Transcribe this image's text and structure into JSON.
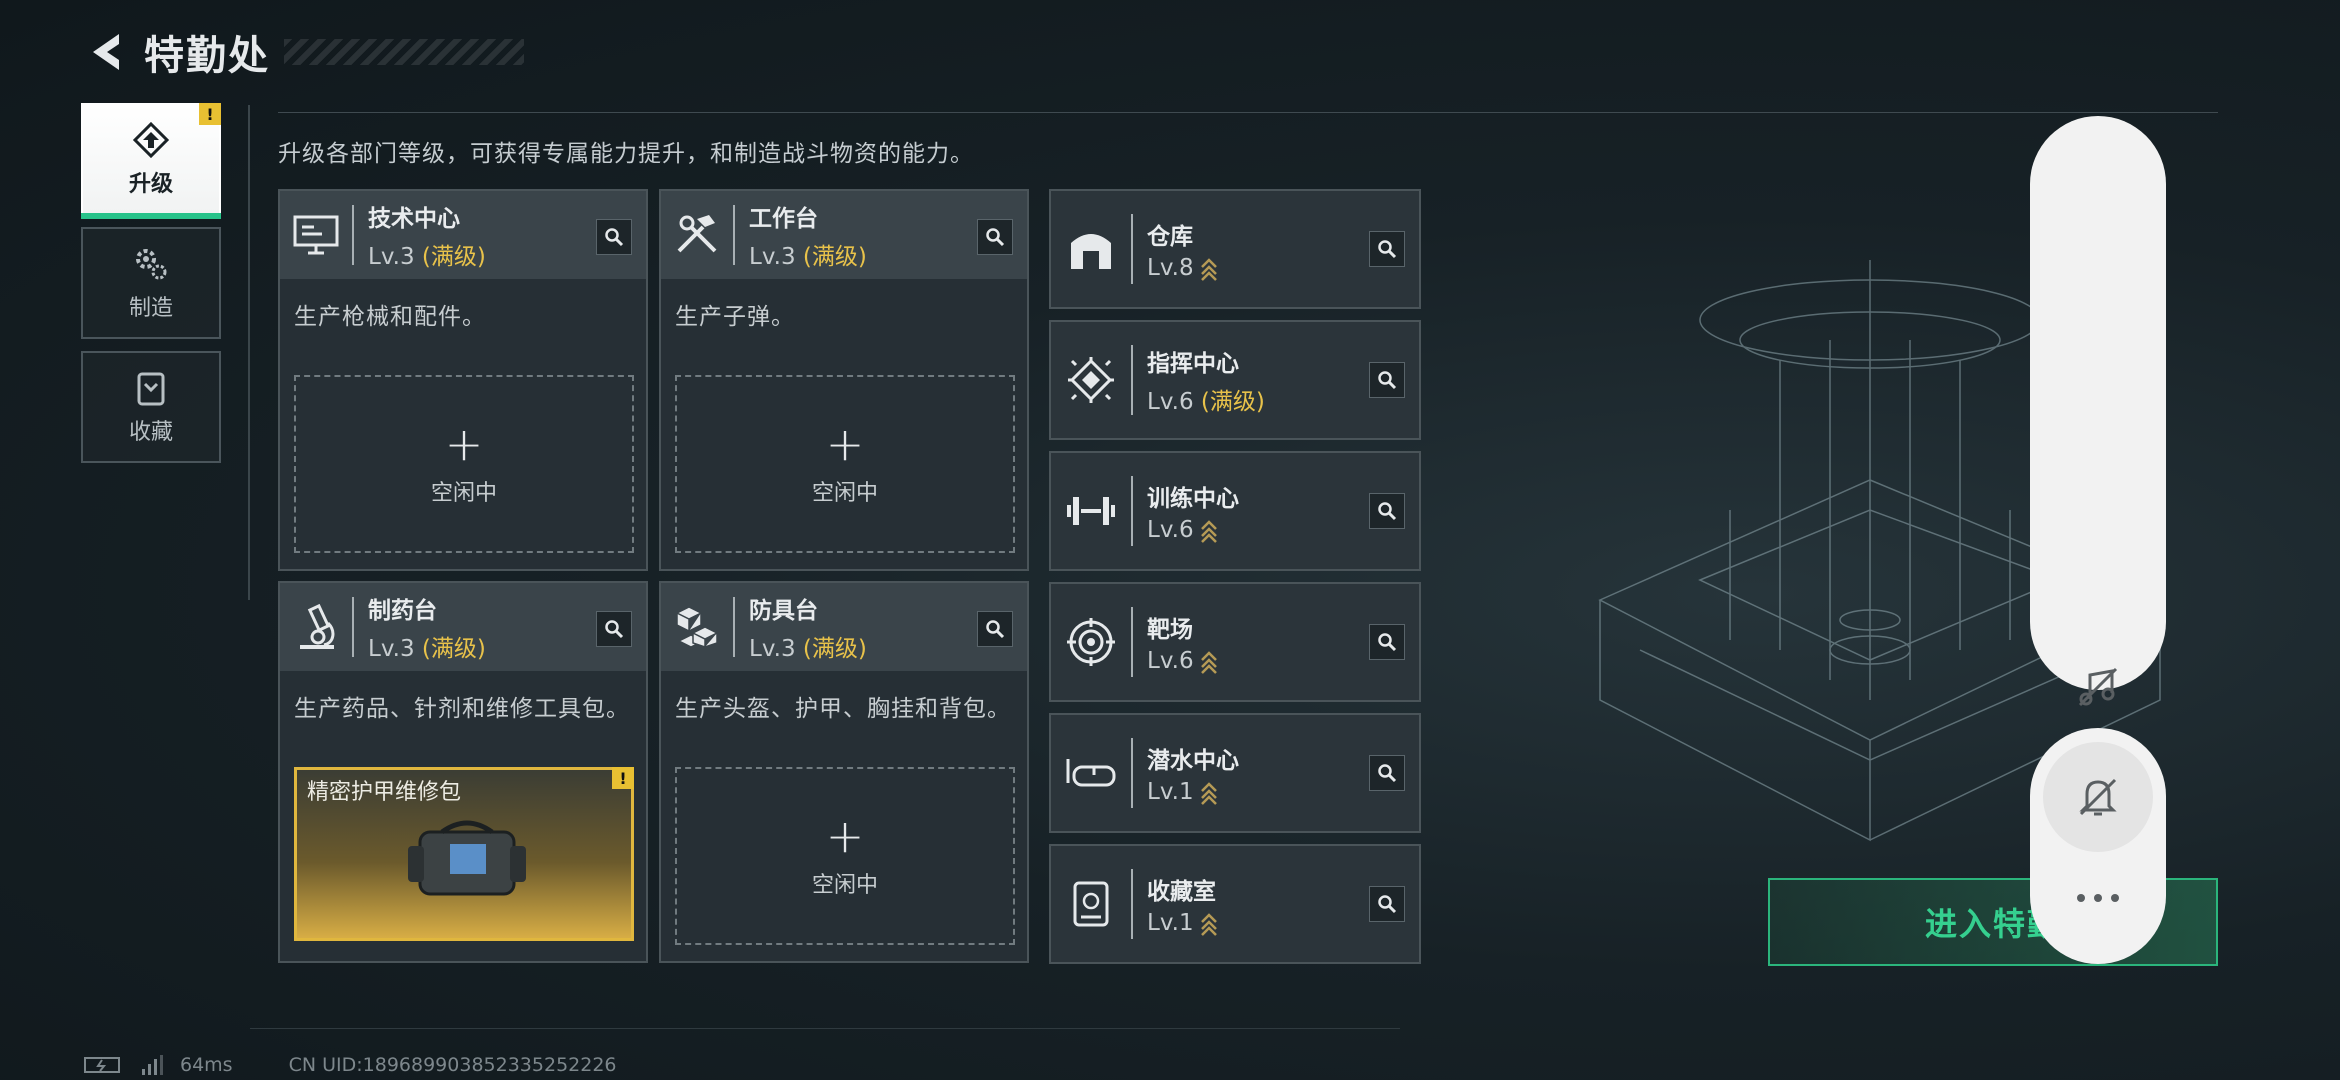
{
  "header": {
    "title": "特勤处"
  },
  "sidebar": {
    "items": [
      {
        "label": "升级",
        "icon": "upgrade-icon",
        "active": true,
        "badge": "!"
      },
      {
        "label": "制造",
        "icon": "gears-icon",
        "active": false
      },
      {
        "label": "收藏",
        "icon": "collection-icon",
        "active": false
      }
    ]
  },
  "hint": "升级各部门等级，可获得专属能力提升，和制造战斗物资的能力。",
  "workshops": [
    {
      "name": "技术中心",
      "level": "Lv.3",
      "max_tag": "(满级)",
      "desc": "生产枪械和配件。",
      "slot_status": "空闲中",
      "icon": "computer-icon"
    },
    {
      "name": "工作台",
      "level": "Lv.3",
      "max_tag": "(满级)",
      "desc": "生产子弹。",
      "slot_status": "空闲中",
      "icon": "tools-icon"
    },
    {
      "name": "制药台",
      "level": "Lv.3",
      "max_tag": "(满级)",
      "desc": "生产药品、针剂和维修工具包。",
      "product_name": "精密护甲维修包",
      "product_badge": "!",
      "icon": "microscope-icon"
    },
    {
      "name": "防具台",
      "level": "Lv.3",
      "max_tag": "(满级)",
      "desc": "生产头盔、护甲、胸挂和背包。",
      "slot_status": "空闲中",
      "icon": "cubes-icon"
    }
  ],
  "facilities": [
    {
      "name": "仓库",
      "level": "Lv.8",
      "max_tag": "",
      "upgradable": true,
      "icon": "warehouse-icon"
    },
    {
      "name": "指挥中心",
      "level": "Lv.6",
      "max_tag": "(满级)",
      "upgradable": false,
      "icon": "chip-icon"
    },
    {
      "name": "训练中心",
      "level": "Lv.6",
      "max_tag": "",
      "upgradable": true,
      "icon": "dumbbell-icon"
    },
    {
      "name": "靶场",
      "level": "Lv.6",
      "max_tag": "",
      "upgradable": true,
      "icon": "target-icon"
    },
    {
      "name": "潜水中心",
      "level": "Lv.1",
      "max_tag": "",
      "upgradable": true,
      "icon": "goggles-icon"
    },
    {
      "name": "收藏室",
      "level": "Lv.1",
      "max_tag": "",
      "upgradable": true,
      "icon": "cabinet-icon"
    }
  ],
  "enter_button": {
    "label": "进入特勤"
  },
  "status": {
    "ping": "64ms",
    "uid": "CN UID:18968990385233525222​6"
  },
  "colors": {
    "accent": "#27c38a",
    "max_level": "#e8c24a",
    "badge": "#e8c032"
  }
}
